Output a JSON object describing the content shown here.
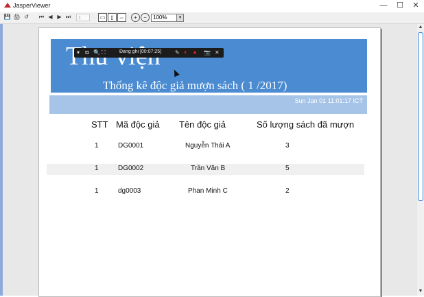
{
  "window": {
    "title": "JasperViewer",
    "minimize": "—",
    "maximize": "☐",
    "close": "✕"
  },
  "toolbar": {
    "save": "💾",
    "print": "🖨",
    "reload": "↺",
    "first": "⏮",
    "prev": "◀",
    "next": "▶",
    "last": "⏭",
    "page_value": "1",
    "actual_size": "▭",
    "fit_page": "▯",
    "fit_width": "⇔",
    "zoom_in": "+",
    "zoom_out": "−",
    "zoom_value": "100%",
    "zoom_arrow": "▾"
  },
  "recorder": {
    "label": "Đang ghi [00:07:25]",
    "icons": [
      "▾",
      "⧉",
      "🔍",
      "⛶",
      "✎",
      "⏸",
      "⏹",
      "📷",
      "✕"
    ]
  },
  "report": {
    "title": "Thư viện",
    "subtitle": "Thống kê độc giả mượn sách ( 1   /2017)",
    "date": "Sun Jan 01 11:01:17 ICT",
    "columns": [
      "STT",
      "Mã độc giả",
      "Tên độc giả",
      "Số lượng sách đã mượn"
    ],
    "rows": [
      [
        "1",
        "DG0001",
        "Nguyễn Thái A",
        "3"
      ],
      [
        "1",
        "DG0002",
        "Trần Văn B",
        "5"
      ],
      [
        "1",
        "dg0003",
        "Phan Minh C",
        "2"
      ]
    ]
  },
  "scroll": {
    "up": "▲",
    "down": "▼"
  }
}
